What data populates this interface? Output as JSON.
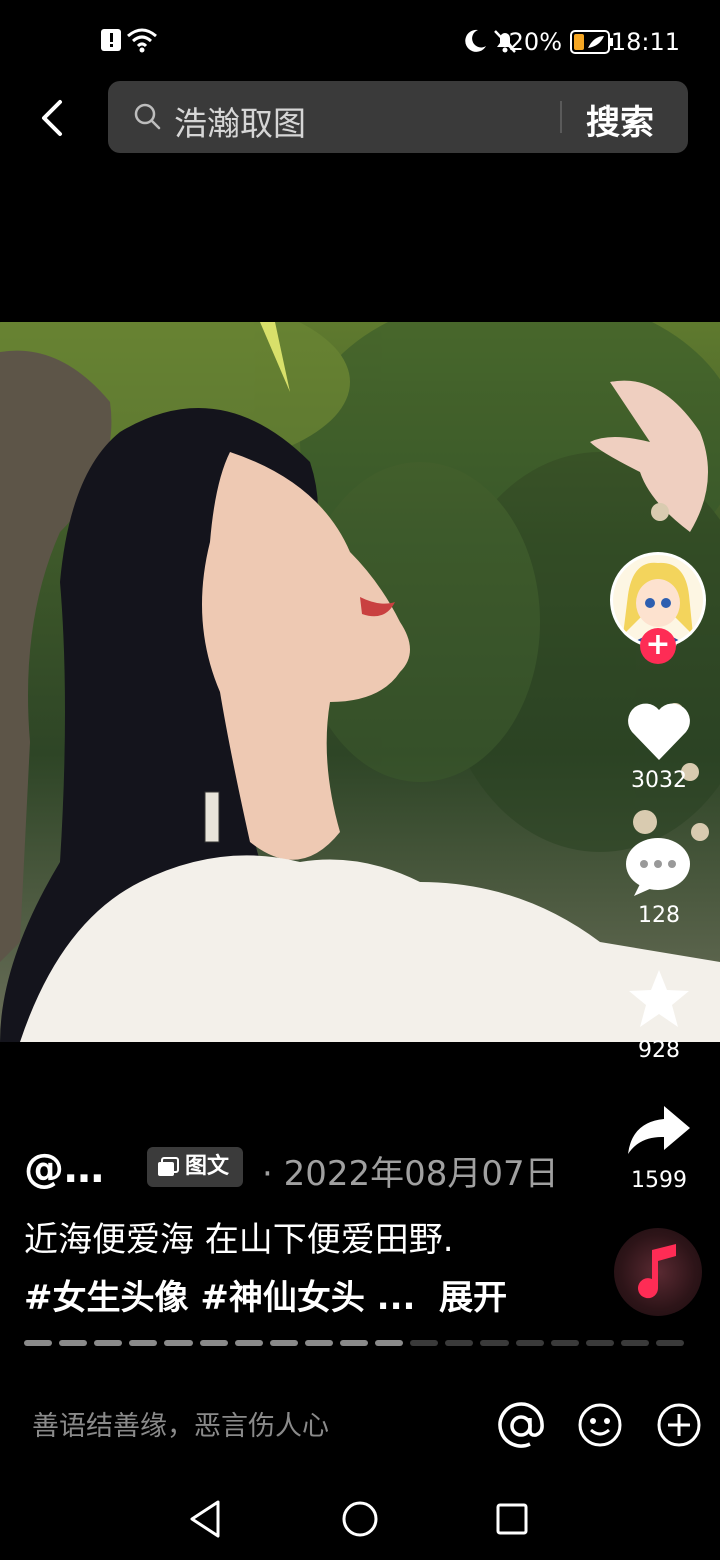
{
  "status_bar": {
    "battery_percent": "20%",
    "time": "18:11",
    "icons": [
      "alert-sim-icon",
      "wifi-icon",
      "moon-icon",
      "bell-off-icon",
      "battery-icon"
    ]
  },
  "search": {
    "query": "浩瀚取图",
    "button_label": "搜索"
  },
  "side_actions": {
    "likes": "3032",
    "comments": "128",
    "favorites": "928",
    "shares": "1599"
  },
  "post": {
    "author": "@…",
    "type_badge": "图文",
    "date_separator": "·",
    "date": "2022年08月07日",
    "description": "近海便爱海 在山下便爱田野.",
    "hashtags": "#女生头像 #神仙女头 ...",
    "expand_label": "展开",
    "progress_total": 19,
    "progress_current": 11
  },
  "comment_bar": {
    "placeholder": "善语结善缘，恶言伤人心"
  },
  "colors": {
    "accent_red": "#fe2c55",
    "search_bg": "#3a3a3a"
  }
}
